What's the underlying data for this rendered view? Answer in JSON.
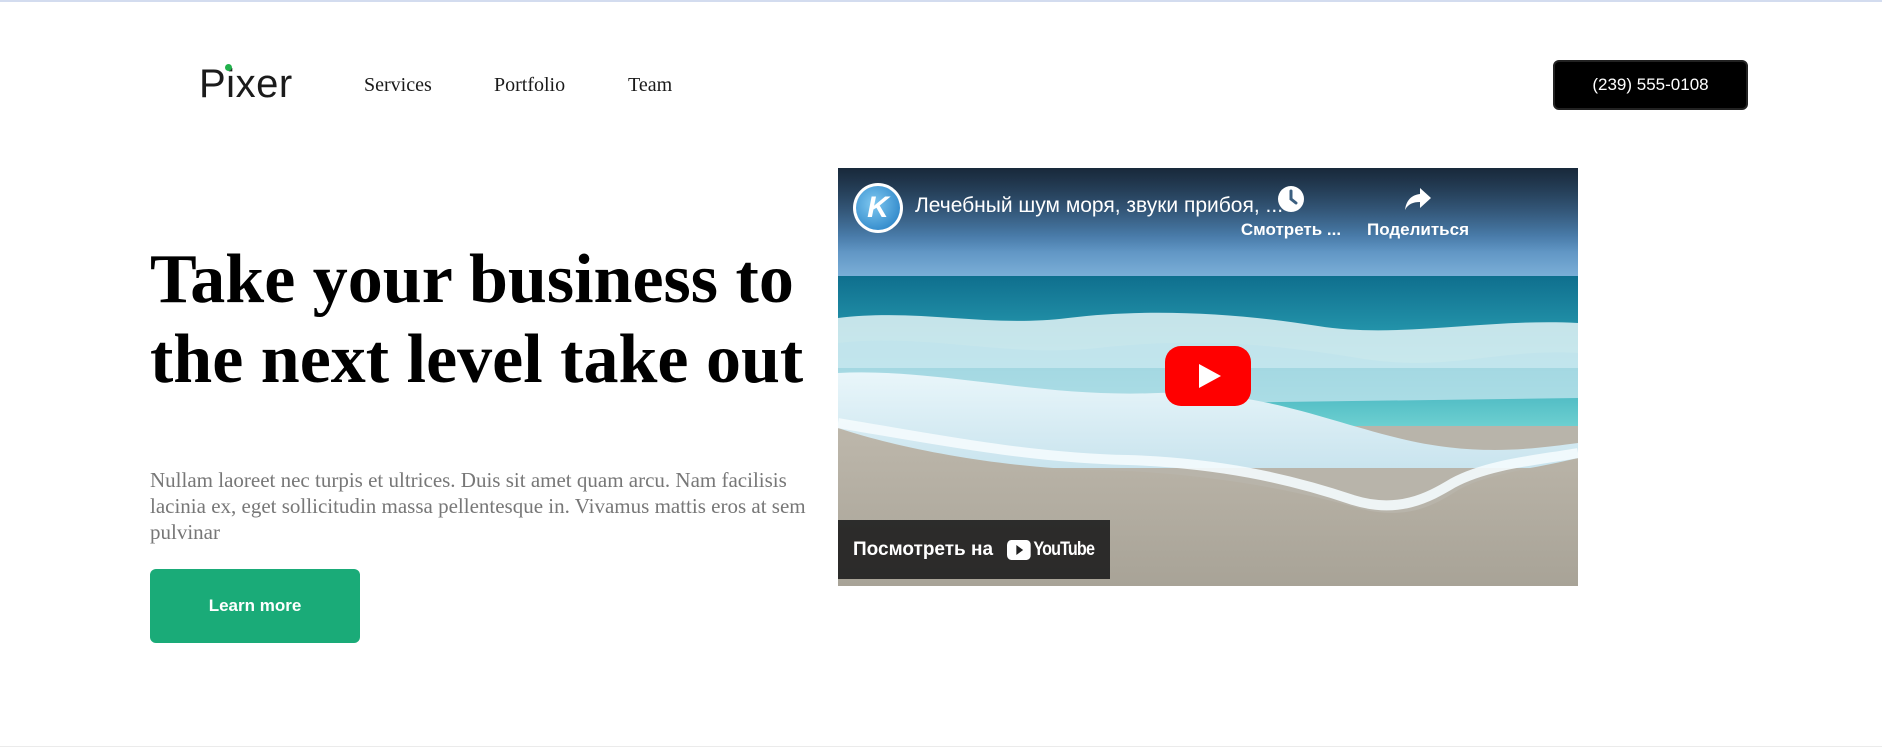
{
  "brand": {
    "name": "Pixer",
    "accent_color": "#22b14c"
  },
  "nav": {
    "items": [
      {
        "label": "Services"
      },
      {
        "label": "Portfolio"
      },
      {
        "label": "Team"
      }
    ]
  },
  "header": {
    "phone_label": "(239) 555-0108"
  },
  "hero": {
    "title": "Take your business to the next level take out",
    "text": "Nullam laoreet nec turpis et ultrices. Duis sit amet quam arcu. Nam facilisis lacinia ex, eget sollicitudin massa pellentesque in. Vivamus mattis eros at sem pulvinar",
    "cta_label": "Learn more",
    "cta_color": "#1aab78"
  },
  "video": {
    "title": "Лечебный шум моря, звуки прибоя, ...",
    "watch_later_label": "Смотреть ...",
    "share_label": "Поделиться",
    "watch_on_label": "Посмотреть на",
    "youtube_label": "YouTube",
    "channel_initial": "K",
    "icons": {
      "channel": "channel-avatar-icon",
      "watch_later": "clock-icon",
      "share": "share-arrow-icon",
      "play": "play-icon",
      "youtube": "youtube-logo-icon"
    }
  }
}
